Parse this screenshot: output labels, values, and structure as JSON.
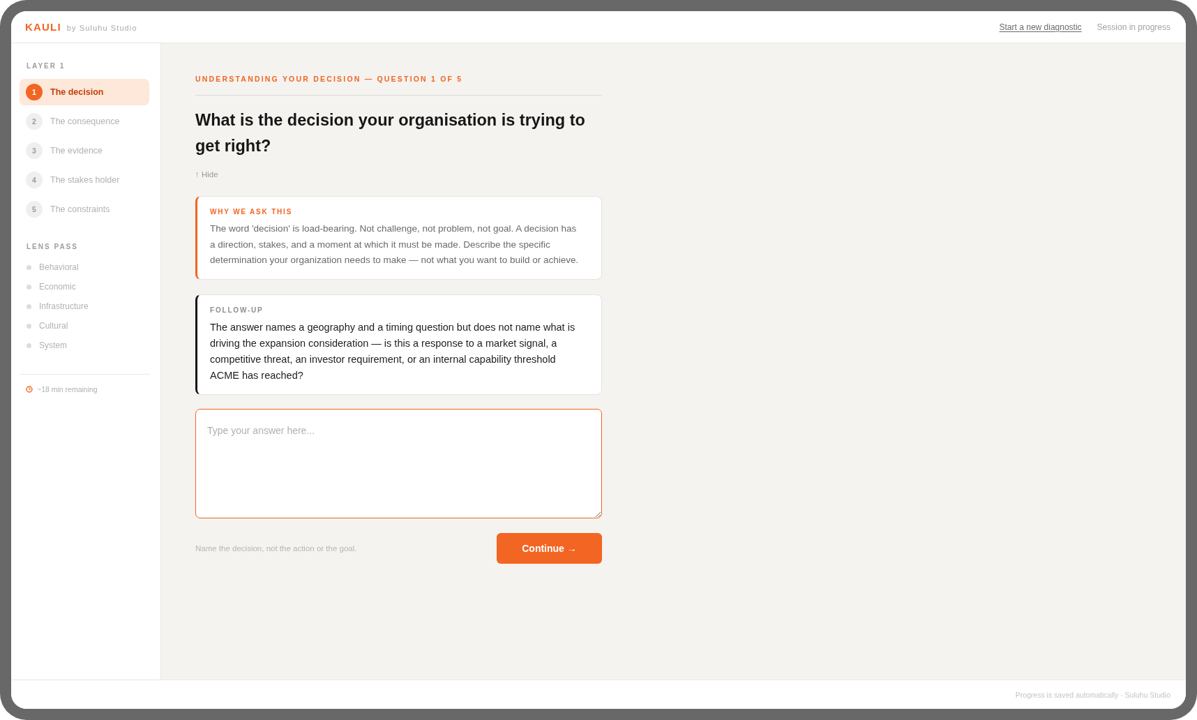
{
  "header": {
    "logo": "KAULI",
    "byline": "by Suluhu Studio",
    "link": "Start a new diagnostic",
    "status": "Session in progress"
  },
  "sidebar": {
    "layer_label": "LAYER 1",
    "steps": [
      {
        "number": "1",
        "label": "The decision",
        "selected": true
      },
      {
        "number": "2",
        "label": "The consequence",
        "selected": false
      },
      {
        "number": "3",
        "label": "The evidence",
        "selected": false
      },
      {
        "number": "4",
        "label": "The stakes holder",
        "selected": false
      },
      {
        "number": "5",
        "label": "The constraints",
        "selected": false
      }
    ],
    "lens_label": "LENS PASS",
    "lenses": [
      {
        "label": "Behavioral"
      },
      {
        "label": "Economic"
      },
      {
        "label": "Infrastructure"
      },
      {
        "label": "Cultural"
      },
      {
        "label": "System"
      }
    ],
    "time_remaining": "~18 min remaining"
  },
  "main": {
    "eyebrow": "UNDERSTANDING YOUR DECISION — QUESTION 1 OF 5",
    "question": "What is the decision your organisation is trying to get right?",
    "hide_toggle": "↑ Hide",
    "cards": [
      {
        "kind": "why",
        "label": "WHY WE ASK THIS",
        "body": "The word 'decision' is load-bearing. Not challenge, not problem, not goal. A decision has a direction, stakes, and a moment at which it must be made. Describe the specific determination your organization needs to make — not what you want to build or achieve."
      },
      {
        "kind": "follow_up",
        "label": "FOLLOW-UP",
        "body": "The answer names a geography and a timing question but does not name what is driving the expansion consideration — is this a response to a market signal, a competitive threat, an investor requirement, or an internal capability threshold ACME has reached?"
      }
    ],
    "answer": {
      "placeholder": "Type your answer here..."
    },
    "hint": "Name the decision, not the action or the goal.",
    "continue_button": "Continue →"
  },
  "footer": "Progress is saved automatically · Suluhu Studio"
}
